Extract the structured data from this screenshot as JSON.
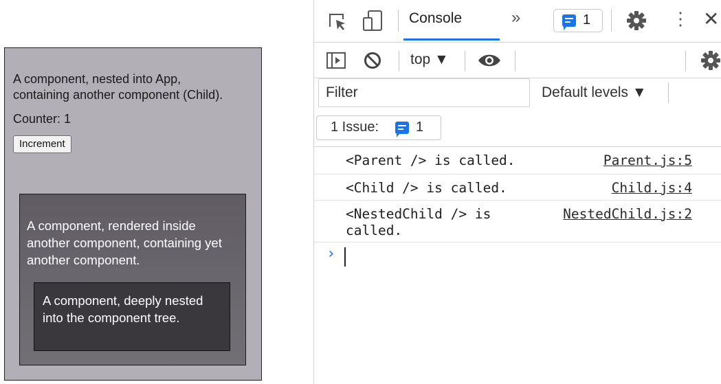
{
  "app": {
    "parent_text": "A component, nested into App, containing another component (Child).",
    "counter_text": "Counter: 1",
    "increment_label": "Increment",
    "child_text": "A component, rendered inside another component, containing yet another component.",
    "nested_child_text": "A component, deeply nested into the component tree."
  },
  "devtools": {
    "tabs": {
      "console_label": "Console",
      "more_tabs": "»",
      "issues_count": "1"
    },
    "toolbar": {
      "context": "top ▼"
    },
    "filter": {
      "placeholder": "Filter",
      "levels_label": "Default levels ▼"
    },
    "issues": {
      "label": "1 Issue:",
      "count": "1"
    },
    "logs": [
      {
        "message": "<Parent /> is called.",
        "source": "Parent.js:5"
      },
      {
        "message": "<Child /> is called.",
        "source": "Child.js:4"
      },
      {
        "message": "<NestedChild /> is\ncalled.",
        "source": "NestedChild.js:2"
      }
    ],
    "prompt": "›"
  },
  "colors": {
    "parent_bg": "#b2afb6",
    "child_bg": "#68646b",
    "nested_bg": "#3b383d",
    "accent": "#1a73e8"
  }
}
